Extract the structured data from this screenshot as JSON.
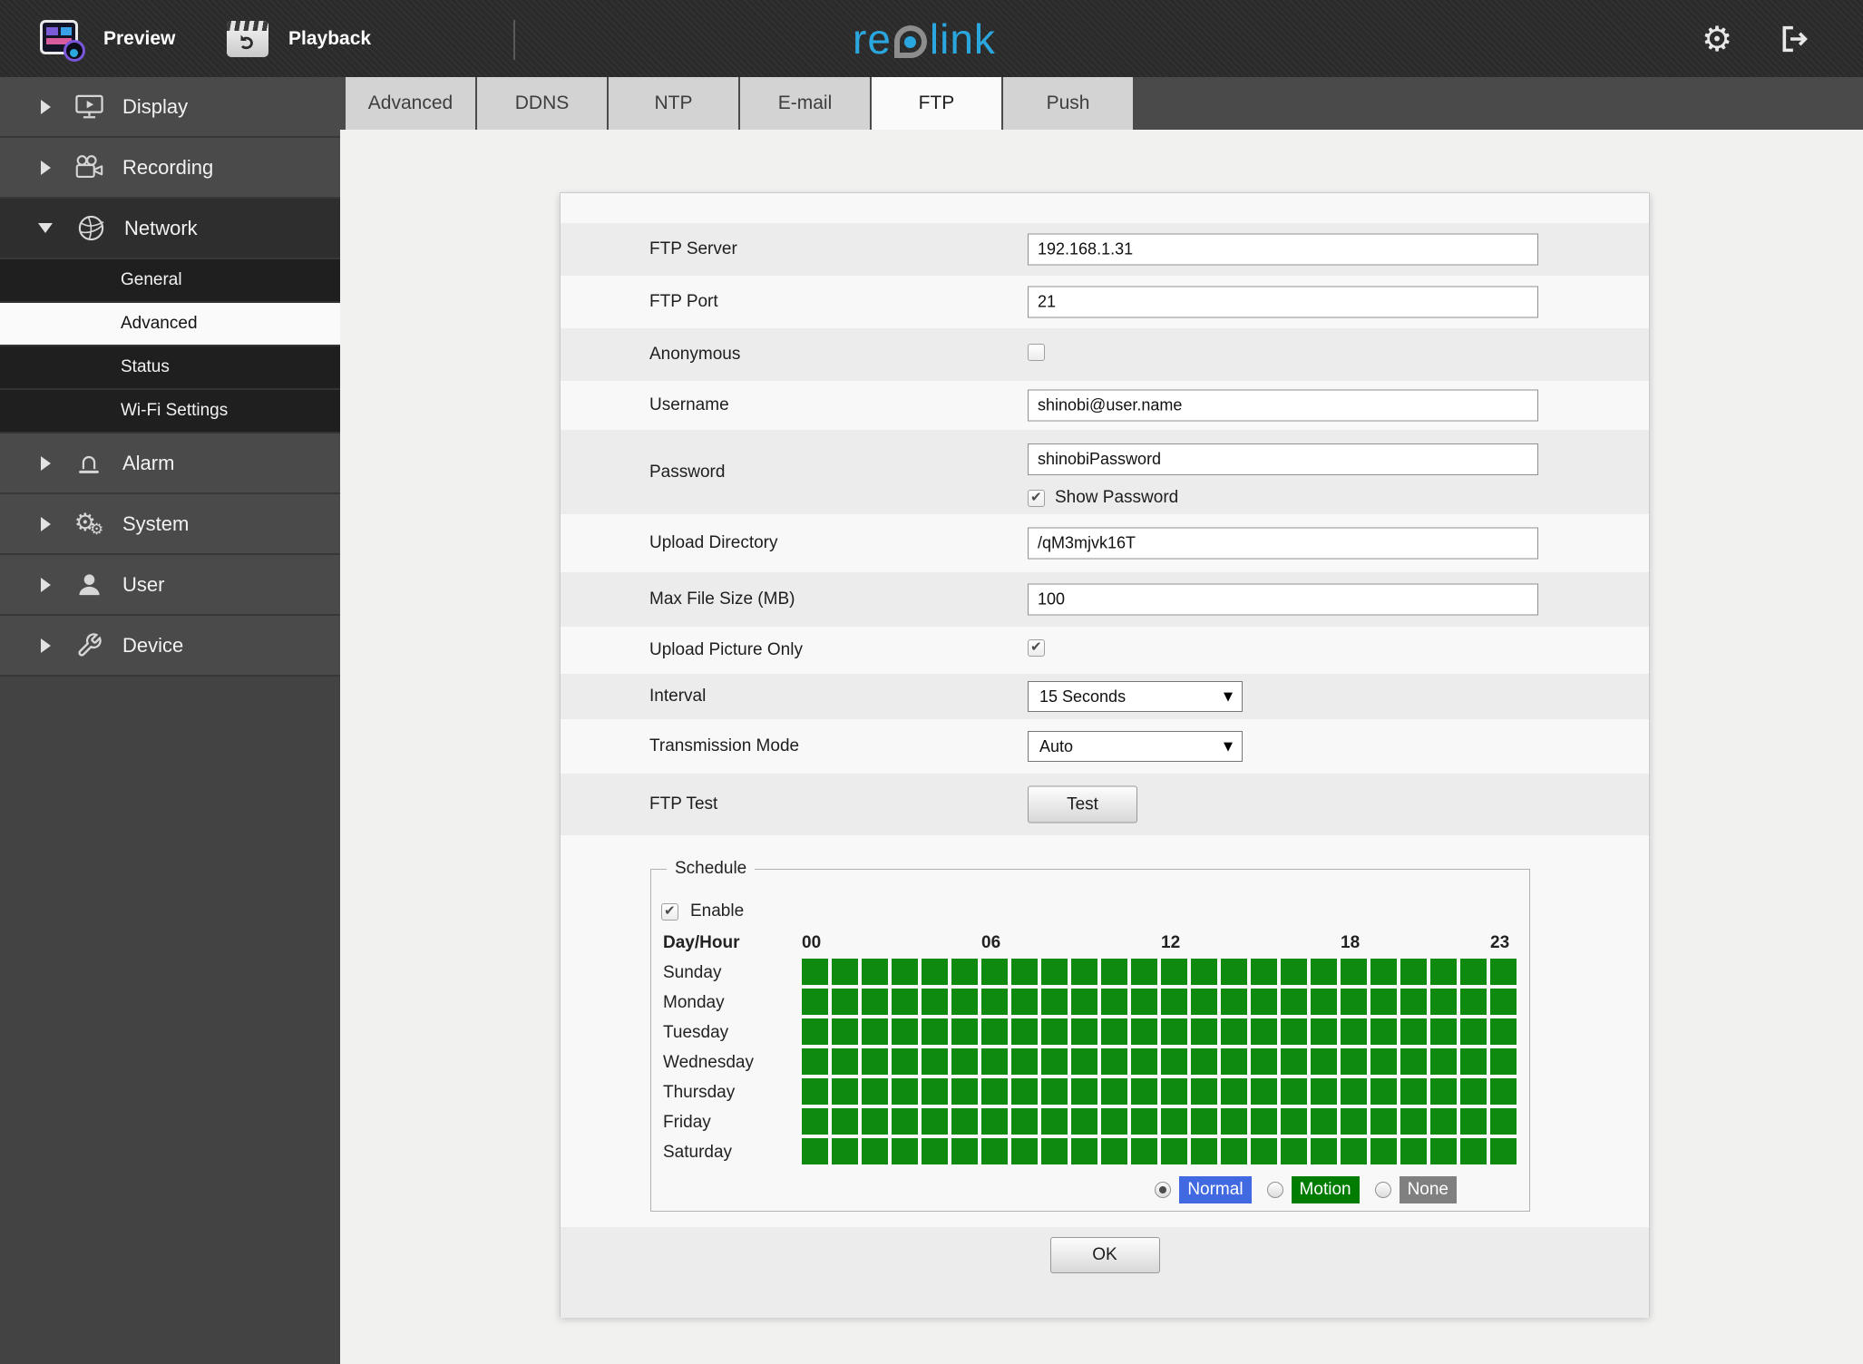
{
  "header": {
    "nav": [
      {
        "label": "Preview"
      },
      {
        "label": "Playback"
      }
    ],
    "logo": {
      "re": "re",
      "link": "link",
      "brand_color": "#2aa7de"
    }
  },
  "sidebar": {
    "items": [
      {
        "label": "Display",
        "icon": "display",
        "expanded": false
      },
      {
        "label": "Recording",
        "icon": "recording",
        "expanded": false
      },
      {
        "label": "Network",
        "icon": "network",
        "expanded": true,
        "children": [
          {
            "label": "General",
            "active": false
          },
          {
            "label": "Advanced",
            "active": true
          },
          {
            "label": "Status",
            "active": false
          },
          {
            "label": "Wi-Fi Settings",
            "active": false
          }
        ]
      },
      {
        "label": "Alarm",
        "icon": "alarm",
        "expanded": false
      },
      {
        "label": "System",
        "icon": "system",
        "expanded": false
      },
      {
        "label": "User",
        "icon": "user",
        "expanded": false
      },
      {
        "label": "Device",
        "icon": "device",
        "expanded": false
      }
    ]
  },
  "tabs": {
    "items": [
      {
        "label": "Advanced",
        "active": false
      },
      {
        "label": "DDNS",
        "active": false
      },
      {
        "label": "NTP",
        "active": false
      },
      {
        "label": "E-mail",
        "active": false
      },
      {
        "label": "FTP",
        "active": true
      },
      {
        "label": "Push",
        "active": false
      }
    ]
  },
  "form": {
    "fields": {
      "ftp_server": {
        "label": "FTP Server",
        "value": "192.168.1.31"
      },
      "ftp_port": {
        "label": "FTP Port",
        "value": "21"
      },
      "anonymous": {
        "label": "Anonymous",
        "checked": false
      },
      "username": {
        "label": "Username",
        "value": "shinobi@user.name"
      },
      "password": {
        "label": "Password",
        "value": "shinobiPassword",
        "show_password_label": "Show Password",
        "show_password_checked": true
      },
      "upload_directory": {
        "label": "Upload Directory",
        "value": "/qM3mjvk16T"
      },
      "max_file_size": {
        "label": "Max File Size (MB)",
        "value": "100"
      },
      "upload_picture_only": {
        "label": "Upload Picture Only",
        "checked": true
      },
      "interval": {
        "label": "Interval",
        "value": "15 Seconds"
      },
      "transmission_mode": {
        "label": "Transmission Mode",
        "value": "Auto"
      },
      "ftp_test": {
        "label": "FTP Test",
        "button_label": "Test"
      }
    }
  },
  "schedule": {
    "legend": "Schedule",
    "enable_label": "Enable",
    "enable_checked": true,
    "corner_label": "Day/Hour",
    "hour_labels": [
      {
        "col": 0,
        "label": "00"
      },
      {
        "col": 6,
        "label": "06"
      },
      {
        "col": 12,
        "label": "12"
      },
      {
        "col": 18,
        "label": "18"
      },
      {
        "col": 23,
        "label": "23"
      }
    ],
    "days": [
      "Sunday",
      "Monday",
      "Tuesday",
      "Wednesday",
      "Thursday",
      "Friday",
      "Saturday"
    ],
    "grid": [
      "111111111111111111111111",
      "111111111111111111111111",
      "111111111111111111111111",
      "111111111111111111111111",
      "111111111111111111111111",
      "111111111111111111111111",
      "111111111111111111111111"
    ],
    "cell_on_color": "#0e8a0e",
    "modes": [
      {
        "label": "Normal",
        "color": "#4169e1",
        "selected": true
      },
      {
        "label": "Motion",
        "color": "#007d00",
        "selected": false
      },
      {
        "label": "None",
        "color": "#808080",
        "selected": false
      }
    ]
  },
  "footer": {
    "ok_label": "OK"
  }
}
